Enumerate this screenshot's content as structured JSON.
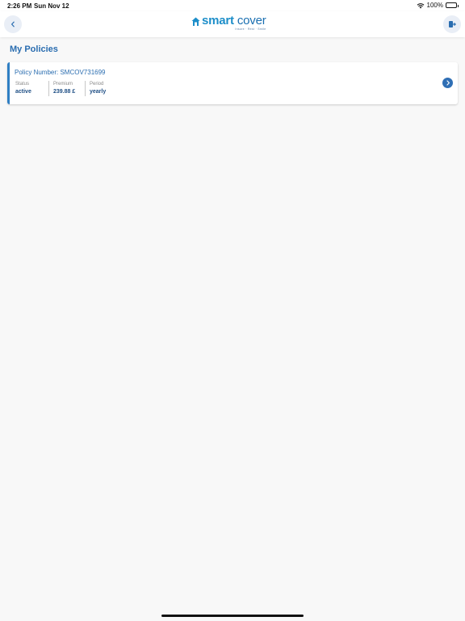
{
  "status_bar": {
    "time": "2:26 PM",
    "date": "Sun Nov 12",
    "battery": "100%"
  },
  "header": {
    "logo_brand": "smart",
    "logo_brand_second": "cover",
    "logo_tagline": "Insure · Rest · Smile",
    "back_icon": "chevron-left-icon",
    "logout_icon": "logout-icon"
  },
  "page": {
    "title": "My Policies"
  },
  "policies": [
    {
      "policy_number": "Policy Number: SMCOV731699",
      "status_label": "Status",
      "status_value": "active",
      "premium_label": "Premium",
      "premium_value": "239.88 £",
      "period_label": "Period",
      "period_value": "yearly"
    }
  ],
  "colors": {
    "accent": "#2a6db0",
    "brand": "#1d8ec9",
    "card_border": "#2f7fc4",
    "background": "#f8f8f8"
  }
}
